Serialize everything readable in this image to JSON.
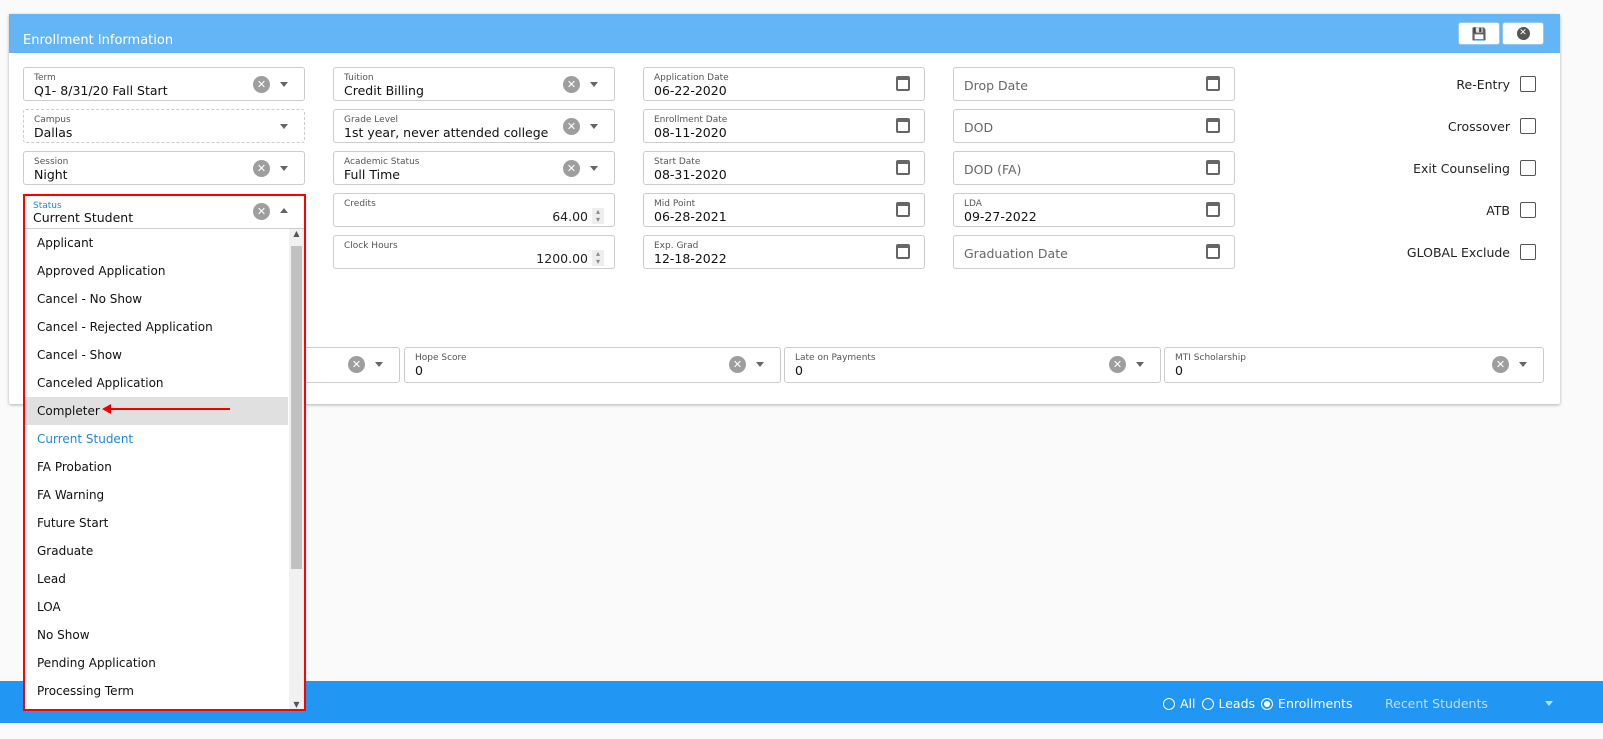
{
  "panel": {
    "title": "Enrollment Information",
    "save_icon": "save-icon",
    "close_icon": "close-circle-icon"
  },
  "col1": [
    {
      "label": "Term",
      "value": "Q1- 8/31/20 Fall Start"
    },
    {
      "label": "Campus",
      "value": "Dallas"
    },
    {
      "label": "Session",
      "value": "Night"
    },
    {
      "label": "Status",
      "value": "Current Student"
    }
  ],
  "col2": [
    {
      "label": "Tuition",
      "value": "Credit Billing"
    },
    {
      "label": "Grade Level",
      "value": "1st year, never attended college"
    },
    {
      "label": "Academic Status",
      "value": "Full Time"
    },
    {
      "label": "Credits",
      "value": "64.00"
    },
    {
      "label": "Clock Hours",
      "value": "1200.00"
    }
  ],
  "col3": [
    {
      "label": "Application Date",
      "value": "06-22-2020"
    },
    {
      "label": "Enrollment Date",
      "value": "08-11-2020"
    },
    {
      "label": "Start Date",
      "value": "08-31-2020"
    },
    {
      "label": "Mid Point",
      "value": "06-28-2021"
    },
    {
      "label": "Exp. Grad",
      "value": "12-18-2022"
    }
  ],
  "col4": [
    {
      "placeholder": "Drop Date"
    },
    {
      "placeholder": "DOD"
    },
    {
      "placeholder": "DOD (FA)"
    },
    {
      "label": "LDA",
      "value": "09-27-2022"
    },
    {
      "placeholder": "Graduation Date"
    }
  ],
  "checkboxes": [
    "Re-Entry",
    "Crossover",
    "Exit Counseling",
    "ATB",
    "GLOBAL Exclude"
  ],
  "bottom": [
    {
      "label": "Hope Score",
      "value": "0"
    },
    {
      "label": "Late on Payments",
      "value": "0"
    },
    {
      "label": "MTI Scholarship",
      "value": "0"
    }
  ],
  "status_options": [
    "Applicant",
    "Approved Application",
    "Cancel - No Show",
    "Cancel - Rejected Application",
    "Cancel - Show",
    "Canceled Application",
    "Completer",
    "Current Student",
    "FA Probation",
    "FA Warning",
    "Future Start",
    "Graduate",
    "Lead",
    "LOA",
    "No Show",
    "Pending Application",
    "Processing Term"
  ],
  "status_highlighted": "Completer",
  "footer": {
    "radios": [
      {
        "label": "All",
        "checked": false
      },
      {
        "label": "Leads",
        "checked": false
      },
      {
        "label": "Enrollments",
        "checked": true
      }
    ],
    "recent": "Recent Students"
  },
  "colors": {
    "header": "#64b5f6",
    "footer": "#2196f3",
    "selected": "#1e88e5",
    "annotation": "#ff0000"
  }
}
